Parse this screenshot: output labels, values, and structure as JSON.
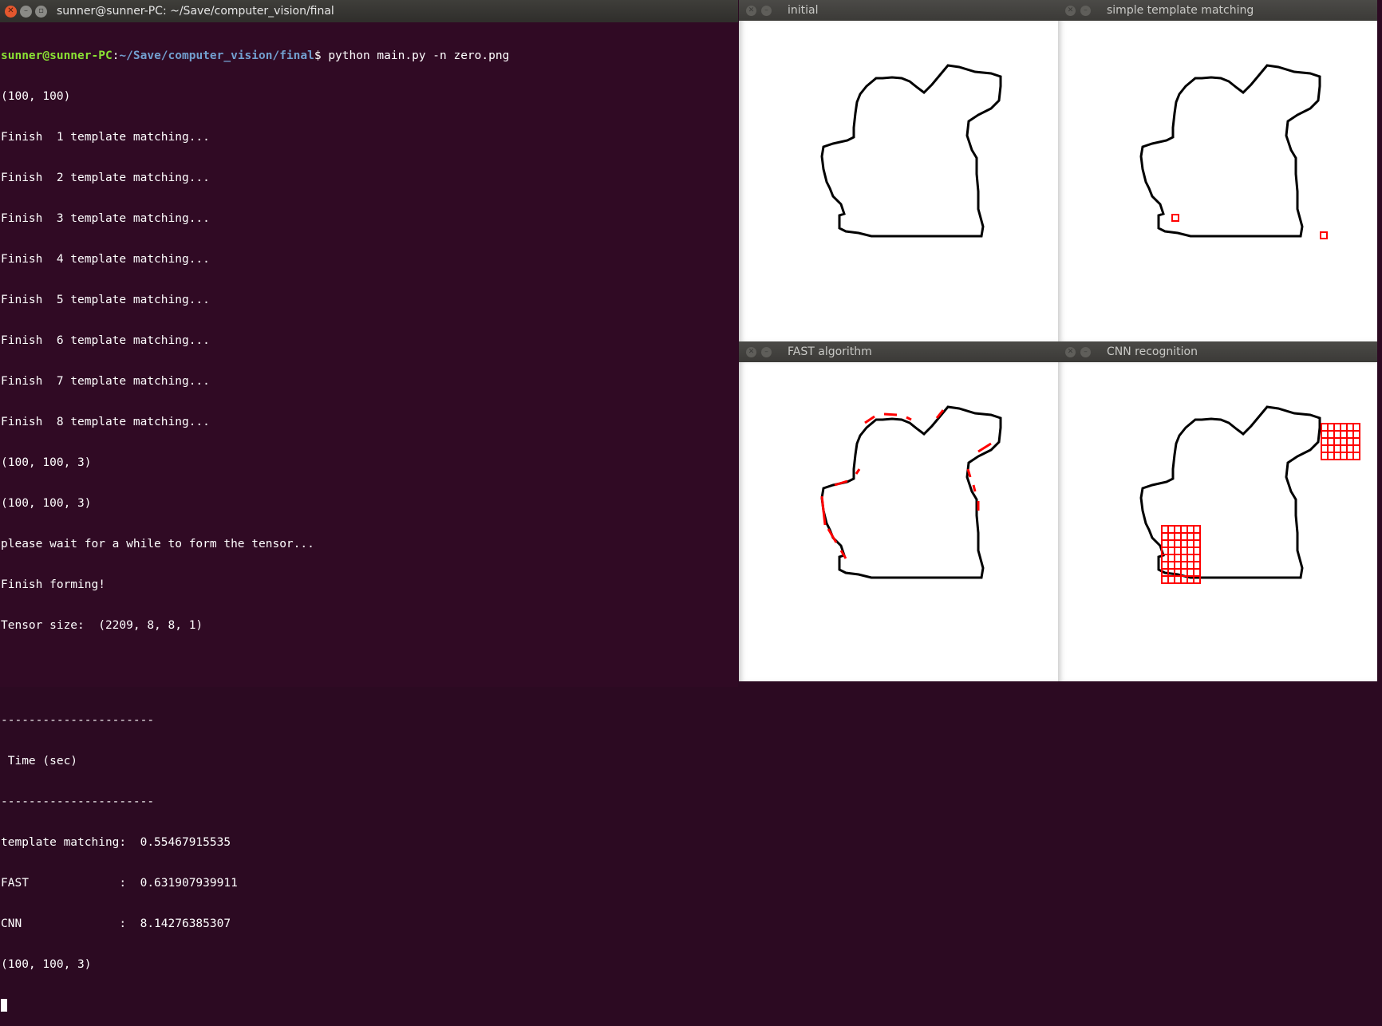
{
  "terminal": {
    "title": "sunner@sunner-PC: ~/Save/computer_vision/final",
    "prompt_user": "sunner@sunner-PC",
    "prompt_sep": ":",
    "prompt_path": "~/Save/computer_vision/final",
    "prompt_symbol": "$ ",
    "command": "python main.py -n zero.png",
    "lines": [
      "(100, 100)",
      "Finish  1 template matching...",
      "Finish  2 template matching...",
      "Finish  3 template matching...",
      "Finish  4 template matching...",
      "Finish  5 template matching...",
      "Finish  6 template matching...",
      "Finish  7 template matching...",
      "Finish  8 template matching...",
      "(100, 100, 3)",
      "(100, 100, 3)",
      "please wait for a while to form the tensor...",
      "Finish forming!",
      "Tensor size:  (2209, 8, 8, 1)",
      "",
      "",
      "----------------------",
      " Time (sec)",
      "----------------------",
      "template matching:  0.55467915535",
      "FAST             :  0.631907939911",
      "CNN              :  8.14276385307",
      "(100, 100, 3)"
    ]
  },
  "windows": {
    "initial": {
      "title": "initial"
    },
    "template": {
      "title": "simple template matching"
    },
    "fast": {
      "title": "FAST algorithm"
    },
    "cnn": {
      "title": "CNN recognition"
    }
  },
  "icons": {
    "close": "close-icon",
    "minimize": "minimize-icon",
    "maximize": "maximize-icon"
  },
  "colors": {
    "terminal_bg": "#300a24",
    "prompt_user": "#8ae234",
    "prompt_path": "#729fcf",
    "marker": "#ff0000"
  }
}
